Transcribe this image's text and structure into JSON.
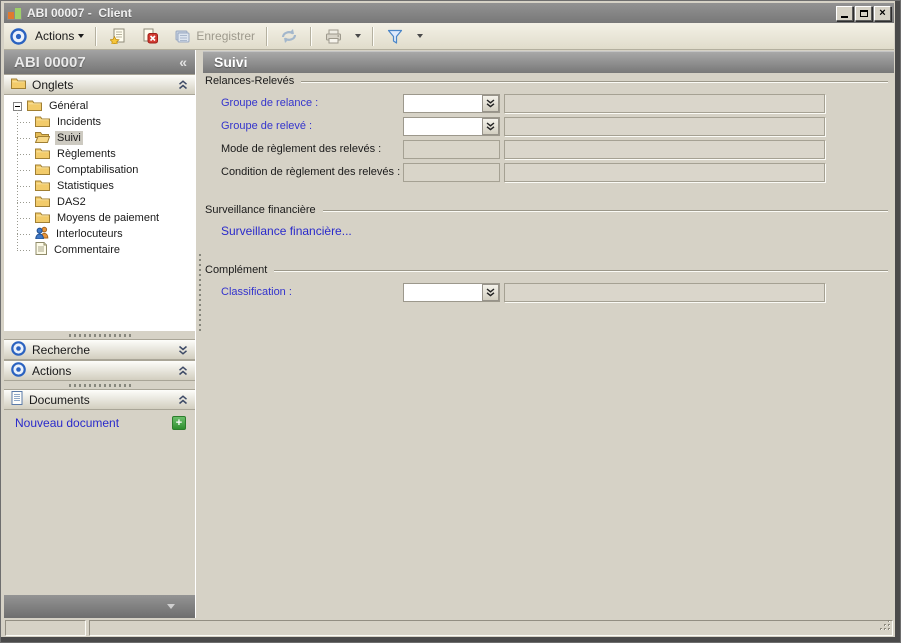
{
  "window": {
    "title": "ABI 00007 -  Client",
    "controls": [
      "minimize",
      "maximize",
      "close"
    ]
  },
  "toolbar": {
    "actions_label": "Actions",
    "save_label": "Enregistrer",
    "icons": [
      "target-icon",
      "new-document-icon",
      "delete-icon",
      "save-icon",
      "refresh-icon",
      "printer-icon",
      "filter-icon"
    ]
  },
  "sidebar": {
    "header": {
      "title": "ABI 00007",
      "collapse_glyph": "«"
    },
    "onglets": {
      "label": "Onglets"
    },
    "tree": {
      "root": {
        "label": "Général",
        "expanded": true
      },
      "items": [
        {
          "label": "Incidents",
          "icon": "folder-closed"
        },
        {
          "label": "Suivi",
          "icon": "folder-open",
          "selected": true
        },
        {
          "label": "Règlements",
          "icon": "folder-closed"
        },
        {
          "label": "Comptabilisation",
          "icon": "folder-closed"
        },
        {
          "label": "Statistiques",
          "icon": "folder-closed"
        },
        {
          "label": "DAS2",
          "icon": "folder-closed"
        },
        {
          "label": "Moyens de paiement",
          "icon": "folder-closed"
        },
        {
          "label": "Interlocuteurs",
          "icon": "people"
        },
        {
          "label": "Commentaire",
          "icon": "note"
        }
      ]
    },
    "recherche": {
      "label": "Recherche",
      "state": "collapsed"
    },
    "actions": {
      "label": "Actions",
      "state": "expanded"
    },
    "documents": {
      "label": "Documents",
      "new_document_label": "Nouveau document"
    }
  },
  "main": {
    "title": "Suivi",
    "relances": {
      "group_label": "Relances-Relevés",
      "fields": [
        {
          "label": "Groupe de relance :",
          "type": "combo",
          "value": "",
          "desc": ""
        },
        {
          "label": "Groupe de relevé :",
          "type": "combo",
          "value": "",
          "desc": ""
        },
        {
          "label": "Mode de règlement des relevés :",
          "type": "readonly",
          "value": "",
          "desc": ""
        },
        {
          "label": "Condition de règlement des relevés :",
          "type": "readonly",
          "value": "",
          "desc": ""
        }
      ]
    },
    "surveillance": {
      "group_label": "Surveillance financière",
      "link_label": "Surveillance financière..."
    },
    "complement": {
      "group_label": "Complément",
      "field": {
        "label": "Classification :",
        "type": "combo",
        "value": "",
        "desc": ""
      }
    }
  },
  "status_bar": {
    "cells": [
      "",
      ""
    ]
  },
  "colors": {
    "link_blue": "#3434cd",
    "header_gray_top": "#a8a8a8",
    "header_gray_bottom": "#787878",
    "window_bg": "#d6d2c6",
    "folder_yellow": "#f2cb6a",
    "selection_gray": "#cdcac1",
    "new_doc_green": "#3aa23a"
  }
}
